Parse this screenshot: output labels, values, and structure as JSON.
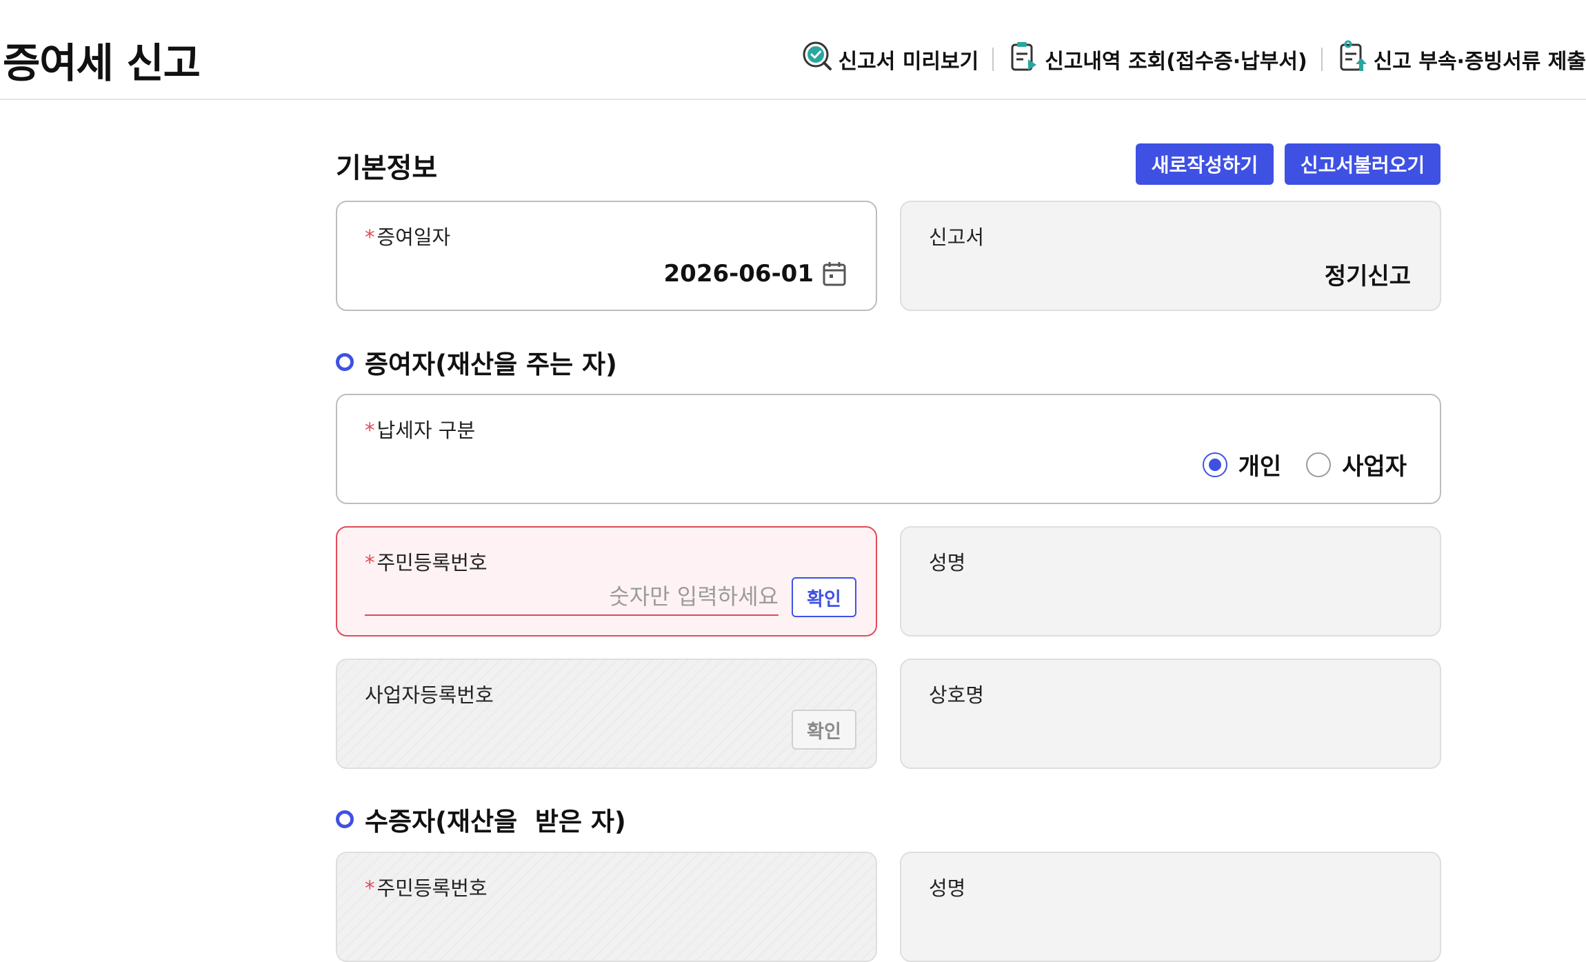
{
  "header": {
    "title": "증여세 신고",
    "links": [
      {
        "label": "신고서 미리보기",
        "icon": "preview-check-icon"
      },
      {
        "label": "신고내역 조회(접수증·납부서)",
        "icon": "document-history-icon"
      },
      {
        "label": "신고 부속·증빙서류 제출",
        "icon": "document-upload-icon"
      }
    ]
  },
  "basic_info": {
    "title": "기본정보",
    "new_button": "새로작성하기",
    "load_button": "신고서불러오기",
    "gift_date": {
      "label": "증여일자",
      "value": "2026-06-01",
      "icon": "calendar-icon"
    },
    "report_type": {
      "label": "신고서",
      "value": "정기신고"
    }
  },
  "donor": {
    "title": "증여자(재산을 주는 자)",
    "taxpayer_type": {
      "label": "납세자 구분",
      "options": [
        {
          "label": "개인",
          "selected": true
        },
        {
          "label": "사업자",
          "selected": false
        }
      ]
    },
    "resident_number": {
      "label": "주민등록번호",
      "placeholder": "숫자만 입력하세요",
      "value": "",
      "confirm": "확인"
    },
    "name": {
      "label": "성명",
      "value": ""
    },
    "business_number": {
      "label": "사업자등록번호",
      "confirm": "확인"
    },
    "company_name": {
      "label": "상호명",
      "value": ""
    }
  },
  "recipient": {
    "title": "수증자(재산을  받은 자)",
    "resident_number": {
      "label": "주민등록번호"
    },
    "name": {
      "label": "성명"
    }
  },
  "colors": {
    "accent": "#3f51e3",
    "error": "#e24a56",
    "required": "#e24a56"
  }
}
